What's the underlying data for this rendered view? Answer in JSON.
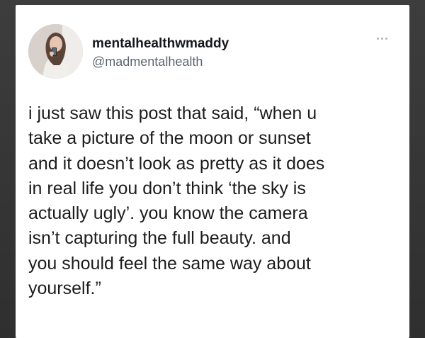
{
  "tweet": {
    "author": {
      "display_name": "mentalhealthwmaddy",
      "handle": "@madmentalhealth",
      "avatar_icon": "profile-photo"
    },
    "more_icon": "more-dots-icon",
    "text": "i just saw this post that said, “when u\ntake a picture of the moon or sunset\nand it doesn’t look as pretty as it does\nin real life you don’t think ‘the sky is\nactually ugly’. you know the camera\nisn’t capturing the full beauty. and\nyou should feel the same way about\nyourself.”"
  },
  "colors": {
    "background": "#3a3a3a",
    "card": "#ffffff",
    "text": "#1c1c1c",
    "handle": "#5b6670"
  }
}
